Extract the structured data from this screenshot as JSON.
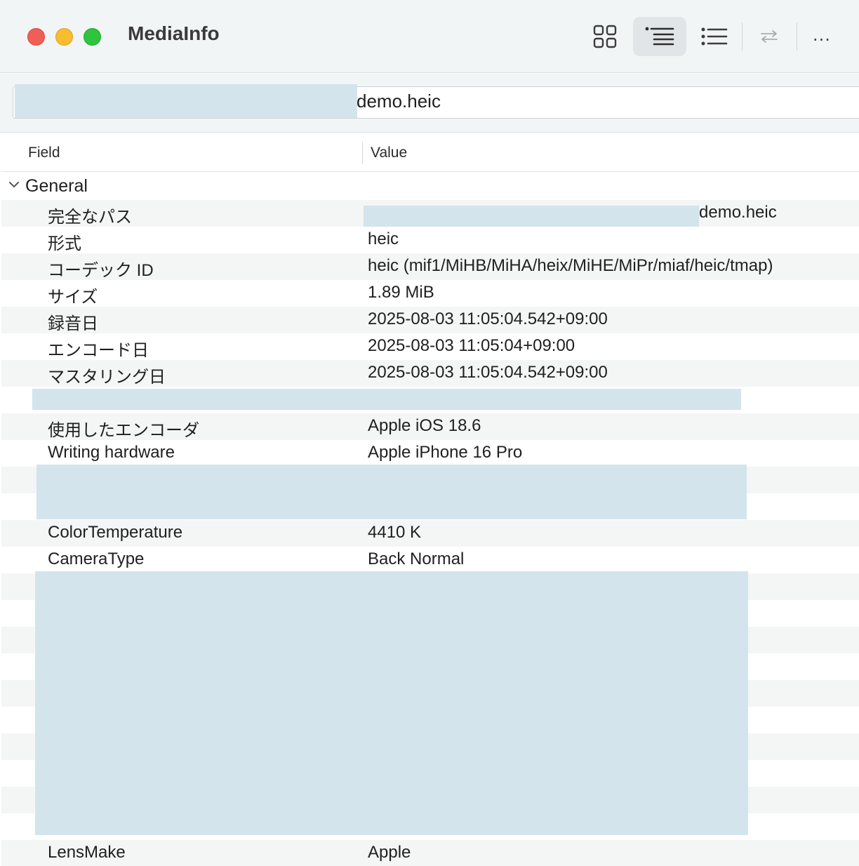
{
  "window": {
    "title": "MediaInfo"
  },
  "toolbar": {
    "view_buttons": [
      {
        "icon": "grid-view-icon"
      },
      {
        "icon": "outline-list-icon",
        "active": true
      },
      {
        "icon": "bullet-list-icon"
      },
      {
        "icon": "swap-arrows-icon"
      }
    ],
    "more_label": "..."
  },
  "path": {
    "filename": "demo.heic"
  },
  "table": {
    "columns": {
      "field": "Field",
      "value": "Value"
    },
    "group": {
      "label": "General",
      "expanded": true
    },
    "rows": [
      {
        "field": "完全なパス",
        "value": "demo.heic"
      },
      {
        "field": "形式",
        "value": "heic"
      },
      {
        "field": "コーデック ID",
        "value": "heic (mif1/MiHB/MiHA/heix/MiHE/MiPr/miaf/heic/tmap)"
      },
      {
        "field": "サイズ",
        "value": "1.89 MiB"
      },
      {
        "field": "録音日",
        "value": "2025-08-03 11:05:04.542+09:00"
      },
      {
        "field": "エンコード日",
        "value": "2025-08-03 11:05:04+09:00"
      },
      {
        "field": "マスタリング日",
        "value": "2025-08-03 11:05:04.542+09:00"
      },
      {
        "field": "",
        "value": ""
      },
      {
        "field": "使用したエンコーダ",
        "value": "Apple iOS 18.6"
      },
      {
        "field": "Writing hardware",
        "value": "Apple iPhone 16 Pro"
      },
      {
        "field": "",
        "value": ""
      },
      {
        "field": "",
        "value": ""
      },
      {
        "field": "ColorTemperature",
        "value": "4410 K"
      },
      {
        "field": "CameraType",
        "value": "Back Normal"
      },
      {
        "field": "",
        "value": ""
      },
      {
        "field": "",
        "value": ""
      },
      {
        "field": "",
        "value": ""
      },
      {
        "field": "",
        "value": ""
      },
      {
        "field": "",
        "value": ""
      },
      {
        "field": "",
        "value": ""
      },
      {
        "field": "",
        "value": ""
      },
      {
        "field": "",
        "value": ""
      },
      {
        "field": "",
        "value": ""
      },
      {
        "field": "",
        "value": ""
      },
      {
        "field": "LensMake",
        "value": "Apple"
      }
    ]
  },
  "colors": {
    "redaction": "#d4e4ec",
    "row_alt": "#f4f5f5",
    "close": "#ee5f57",
    "minimize": "#f7bd2f",
    "zoom": "#2ec440"
  }
}
